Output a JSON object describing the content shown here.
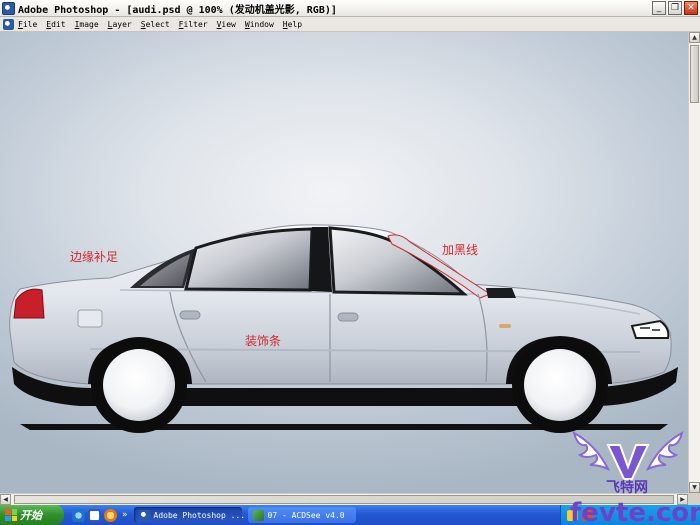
{
  "window": {
    "title": "Adobe Photoshop - [audi.psd @ 100% (发动机盖光影, RGB)]",
    "controls": {
      "minimize": "_",
      "restore": "❐",
      "close": "✕"
    }
  },
  "menu": {
    "items": [
      "File",
      "Edit",
      "Image",
      "Layer",
      "Select",
      "Filter",
      "View",
      "Window",
      "Help"
    ]
  },
  "canvas": {
    "annotations": {
      "edge_fill": "边缘补足",
      "trim_strip": "装饰条",
      "darken_line": "加黑线"
    },
    "colors": {
      "annotation": "#d02a2a",
      "body": "#e3e7ee",
      "tail_light": "#c8202a"
    }
  },
  "taskbar": {
    "start_label": "开始",
    "quicklaunch_more": "»",
    "tasks": [
      {
        "label": "Adobe Photoshop ...",
        "active": true
      },
      {
        "label": "07 - ACDSee v4.0",
        "active": false
      }
    ]
  },
  "watermark": {
    "brand": "飞特网",
    "url": "fevte.com",
    "letter": "V"
  }
}
